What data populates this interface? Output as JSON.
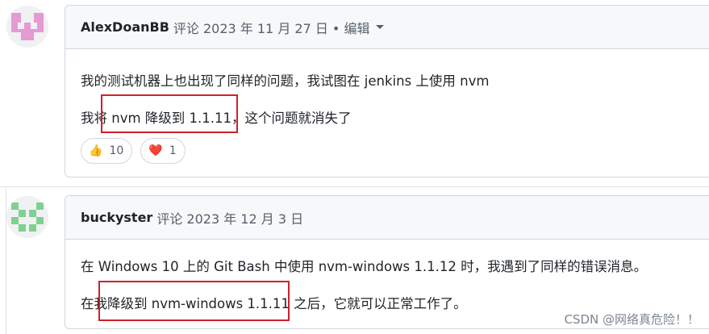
{
  "comments": [
    {
      "author": "AlexDoanBB",
      "meta": "评论 2023 年 11 月 27 日 • 编辑",
      "lines": [
        "我的测试机器上也出现了同样的问题，我试图在 jenkins 上使用 nvm",
        "我将 nvm 降级到 1.1.11，这个问题就消失了"
      ],
      "reactions": [
        {
          "emoji": "👍",
          "count": "10"
        },
        {
          "emoji": "❤️",
          "count": "1"
        }
      ]
    },
    {
      "author": "buckyster",
      "meta": "评论 2023 年 12 月 3 日",
      "lines": [
        "在 Windows 10 上的 Git Bash 中使用 nvm-windows 1.1.12 时，我遇到了同样的错误消息。",
        "在我降级到 nvm-windows 1.1.11 之后，它就可以正常工作了。"
      ]
    }
  ],
  "watermark": "CSDN @网络真危险！！",
  "colors": {
    "highlight_box": "#d0202a",
    "avatar1": "#e59ad3",
    "avatar2": "#7fd190"
  }
}
